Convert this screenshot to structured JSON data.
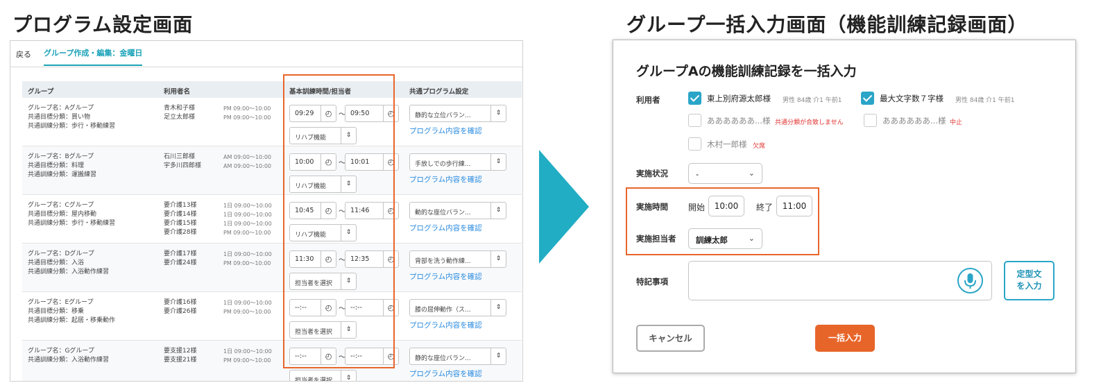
{
  "left_title": "プログラム設定画面",
  "right_title": "グループ一括入力画面（機能訓練記録画面）",
  "left": {
    "back_label": "戻る",
    "active_tab": "グループ作成・編集：金曜日",
    "headers": {
      "group": "グループ",
      "users": "利用者名",
      "basic_time": "基本訓練時間/担当者",
      "common_program": "共通プログラム設定"
    },
    "rows": [
      {
        "group": [
          "グループ名：Aグループ",
          "共通目標分類：買い物",
          "共通訓練分類：歩行・移動練習"
        ],
        "users": [
          "青木和子様",
          "足立太郎様"
        ],
        "times": [
          "PM 09:00〜10:00",
          "PM 09:00〜10:00"
        ],
        "start": "09:29",
        "end": "09:50",
        "staff": "リハブ機能",
        "program": "静的な立位バラン...",
        "link": "プログラム内容を確認"
      },
      {
        "group": [
          "グループ名：Bグループ",
          "共通目標分類：料理",
          "共通訓練分類：運搬練習"
        ],
        "users": [
          "石川三郎様",
          "宇多川四郎様"
        ],
        "times": [
          "AM 09:00〜10:00",
          "AM 09:00〜10:00"
        ],
        "start": "10:00",
        "end": "10:01",
        "staff": "リハブ機能",
        "program": "手放しでの歩行練...",
        "link": "プログラム内容を確認"
      },
      {
        "group": [
          "グループ名：Cグループ",
          "共通目標分類：屋内移動",
          "共通訓練分類：歩行・移動練習"
        ],
        "users": [
          "要介護13様",
          "要介護14様",
          "要介護15様",
          "要介護28様"
        ],
        "times": [
          "1日 09:00〜10:00",
          "1日 09:00〜10:00",
          "1日 09:00〜10:00",
          "PM 09:00〜10:00"
        ],
        "start": "10:45",
        "end": "11:46",
        "staff": "リハブ機能",
        "program": "動的な座位バラン...",
        "link": "プログラム内容を確認"
      },
      {
        "group": [
          "グループ名：Dグループ",
          "共通目標分類：入浴",
          "共通訓練分類：入浴動作練習"
        ],
        "users": [
          "要介護17様",
          "要介護24様"
        ],
        "times": [
          "1日 09:00〜10:00",
          "PM 09:00〜10:00"
        ],
        "start": "11:30",
        "end": "12:35",
        "staff": "担当者を選択",
        "program": "背部を洗う動作練...",
        "link": "プログラム内容を確認"
      },
      {
        "group": [
          "グループ名：Eグループ",
          "共通目標分類：移乗",
          "共通訓練分類：起居・移乗動作"
        ],
        "users": [
          "要介護16様",
          "要介護26様"
        ],
        "times": [
          "1日 09:00〜10:00",
          "PM 09:00〜10:00"
        ],
        "start": "--:--",
        "end": "--:--",
        "staff": "担当者を選択",
        "program": "膝の屈伸動作（ス...",
        "link": "プログラム内容を確認"
      },
      {
        "group": [
          "グループ名：Gグループ",
          "共通訓練分類：入浴動作練習"
        ],
        "users": [
          "要支援12様",
          "要支援21様"
        ],
        "times": [
          "1日 09:00〜10:00",
          "PM 09:00〜10:00"
        ],
        "start": "--:--",
        "end": "--:--",
        "staff": "担当者を選択",
        "program": "静的な座位バラン...",
        "link": "プログラム内容を確認"
      }
    ]
  },
  "right": {
    "title": "グループAの機能訓練記録を一括入力",
    "users_label": "利用者",
    "users": [
      {
        "name": "東上別府源太郎様",
        "meta": "男性 84歳 介1 午前1",
        "warning": "",
        "checked": true
      },
      {
        "name": "最大文字数７字様",
        "meta": "男性 84歳 介1 午前1",
        "warning": "",
        "checked": true
      },
      {
        "name": "ああああああ...様",
        "meta": "",
        "warning": "共通分類が合致しません",
        "checked": false
      },
      {
        "name": "ああああああ...様",
        "meta": "",
        "warning": "中止",
        "checked": false
      },
      {
        "name": "木村一郎様",
        "meta": "",
        "warning": "欠席",
        "checked": false
      }
    ],
    "status_label": "実施状況",
    "status_value": "-",
    "time_label": "実施時間",
    "start_label": "開始",
    "start_value": "10:00",
    "end_label": "終了",
    "end_value": "11:00",
    "staff_label": "実施担当者",
    "staff_value": "訓練太郎",
    "notes_label": "特記事項",
    "template_button_line1": "定型文",
    "template_button_line2": "を入力",
    "cancel_label": "キャンセル",
    "submit_label": "一括入力",
    "colors": {
      "accent": "#2aa5c8",
      "orange": "#e8652a",
      "warning": "#e0322f",
      "link": "#2a8be0"
    },
    "icons": {
      "mic": "microphone-icon",
      "chevron": "chevron-down-icon",
      "check": "checkmark-icon"
    }
  }
}
